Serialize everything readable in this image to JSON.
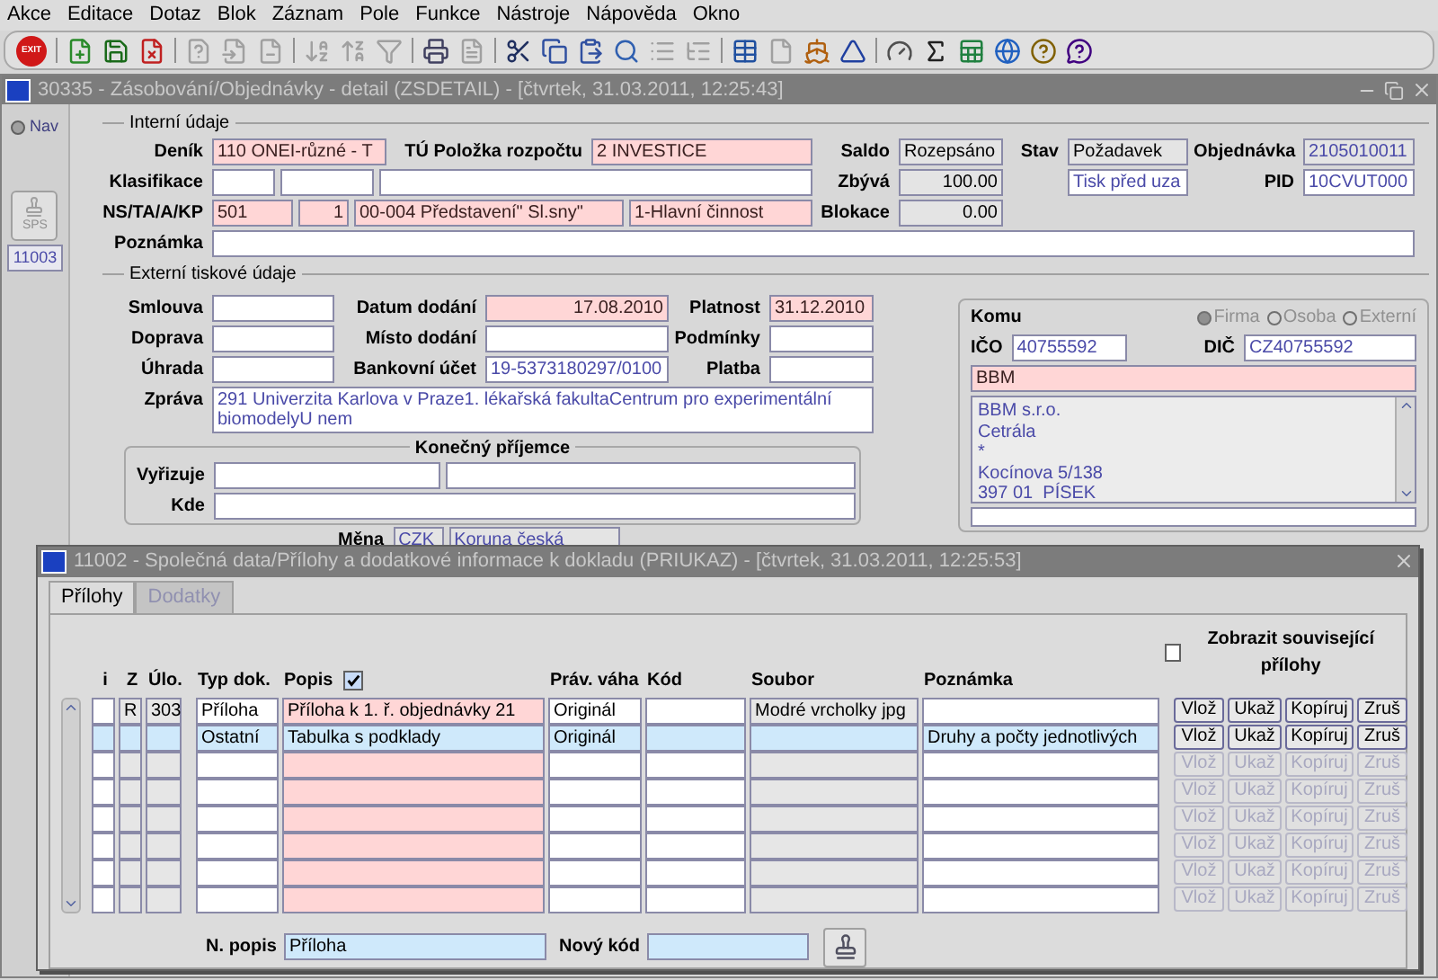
{
  "menu": [
    "Akce",
    "Editace",
    "Dotaz",
    "Blok",
    "Záznam",
    "Pole",
    "Funkce",
    "Nástroje",
    "Nápověda",
    "Okno"
  ],
  "toolbar": {
    "exit_label": "EXIT"
  },
  "main_window": {
    "title": "30335 - Zásobování/Objednávky - detail (ZSDETAIL) - [čtvrtek, 31.03.2011, 12:25:43]",
    "nav": {
      "label": "Nav",
      "selected": true
    },
    "sps_label": "SPS",
    "record_id": "11003"
  },
  "internal": {
    "legend": "Interní údaje",
    "denik": {
      "label": "Deník",
      "value": "110 ONEI-různé - T",
      "kind": "required"
    },
    "tu_polozka": {
      "label": "TÚ Položka rozpočtu",
      "value": "2 INVESTICE",
      "kind": "required"
    },
    "saldo": {
      "label": "Saldo",
      "value": "Rozepsáno",
      "kind": "readonly"
    },
    "stav": {
      "label": "Stav",
      "value": "Požadavek",
      "kind": "readonly"
    },
    "objednavka": {
      "label": "Objednávka",
      "value": "2105010011",
      "kind": "locked"
    },
    "klasifikace": {
      "label": "Klasifikace",
      "fields": [
        {
          "kind": "plain"
        },
        {
          "kind": "plain"
        },
        {
          "kind": "plain"
        }
      ]
    },
    "zbyva": {
      "label": "Zbývá",
      "value": "100.00",
      "kind": "readonly"
    },
    "tisk": {
      "value": "Tisk před uza",
      "kind": "display"
    },
    "pid": {
      "label": "PID",
      "value": "10CVUT000",
      "kind": "display"
    },
    "ns": {
      "label": "NS/TA/A/KP",
      "fields": [
        {
          "value": "501",
          "kind": "required"
        },
        {
          "value": "1",
          "kind": "required"
        },
        {
          "value": "00-004 Představení\" Sl.sny\"",
          "kind": "required"
        },
        {
          "value": "1-Hlavní činnost",
          "kind": "required"
        }
      ]
    },
    "blokace": {
      "label": "Blokace",
      "value": "0.00",
      "kind": "readonly"
    },
    "poznamka": {
      "label": "Poznámka",
      "kind": "plain"
    }
  },
  "external": {
    "legend": "Externí tiskové údaje",
    "smlouva": {
      "label": "Smlouva",
      "kind": "plain"
    },
    "datum_dodani": {
      "label": "Datum dodání",
      "value": "17.08.2010",
      "kind": "required"
    },
    "platnost": {
      "label": "Platnost",
      "value": "31.12.2010",
      "kind": "required"
    },
    "doprava": {
      "label": "Doprava",
      "kind": "plain"
    },
    "misto_dodani": {
      "label": "Místo dodání",
      "kind": "plain"
    },
    "podminky": {
      "label": "Podmínky",
      "kind": "plain"
    },
    "uhrada": {
      "label": "Úhrada",
      "kind": "plain"
    },
    "bankovni_ucet": {
      "label": "Bankovní účet",
      "value": "19-5373180297/0100",
      "kind": "display"
    },
    "platba": {
      "label": "Platba",
      "kind": "plain"
    },
    "zprava": {
      "label": "Zpráva",
      "value": "291 Univerzita Karlova v Praze1. lékařská fakultaCentrum pro experimentální biomodelyU nem",
      "kind": "display"
    },
    "konecny": {
      "legend": "Konečný příjemce",
      "vyrizuje": {
        "label": "Vyřizuje",
        "fields": [
          {
            "kind": "plain"
          },
          {
            "kind": "plain"
          }
        ]
      },
      "kde": {
        "label": "Kde",
        "kind": "plain"
      }
    },
    "mena": {
      "label": "Měna",
      "fields": [
        {
          "value": "CZK",
          "kind": "locked"
        },
        {
          "value": "Koruna česká",
          "kind": "locked"
        }
      ]
    },
    "komu": {
      "legend": "Komu",
      "radios": [
        {
          "label": "Firma",
          "selected": true
        },
        {
          "label": "Osoba",
          "selected": false
        },
        {
          "label": "Externí",
          "selected": false
        }
      ],
      "ico": {
        "label": "IČO",
        "value": "40755592",
        "kind": "display"
      },
      "dic": {
        "label": "DIČ",
        "value": "CZ40755592",
        "kind": "display"
      },
      "name": {
        "value": "BBM",
        "kind": "required"
      },
      "address_lines": [
        "BBM s.r.o.",
        "Cetrála",
        "*",
        "Kocínova 5/138",
        "397 01  PÍSEK"
      ],
      "extra": {
        "kind": "plain"
      }
    }
  },
  "dialog": {
    "title": "11002 - Společná data/Přílohy a dodatkové informace k dokladu (PRIUKAZ) - [čtvrtek, 31.03.2011, 12:25:53]",
    "tabs": [
      {
        "label": "Přílohy",
        "selected": true
      },
      {
        "label": "Dodatky",
        "selected": false
      }
    ],
    "show_related": {
      "label": "Zobrazit související přílohy",
      "checked": false
    },
    "columns": [
      "i",
      "Z",
      "Úlo.",
      "Typ dok.",
      "Popis",
      "Práv. váha",
      "Kód",
      "Soubor",
      "Poznámka"
    ],
    "popis_checkbox": {
      "checked": true
    },
    "rows": [
      {
        "selected": false,
        "enabled": true,
        "cells": {
          "z": "R",
          "ulo": "303",
          "typ": "Příloha",
          "popis": "Příloha k 1. ř. objednávky 21",
          "prav": "Originál",
          "soubor": "Modré vrcholky jpg"
        },
        "buttons": [
          "Vlož",
          "Ukaž",
          "Kopíruj",
          "Zruš"
        ]
      },
      {
        "selected": true,
        "enabled": true,
        "cells": {
          "typ": "Ostatní",
          "popis": "Tabulka s podklady",
          "prav": "Originál",
          "poznamka": "Druhy a počty jednotlivých"
        },
        "buttons": [
          "Vlož",
          "Ukaž",
          "Kopíruj",
          "Zruš"
        ]
      },
      {
        "selected": false,
        "enabled": false,
        "cells": {},
        "buttons": [
          "Vlož",
          "Ukaž",
          "Kopíruj",
          "Zruš"
        ]
      },
      {
        "selected": false,
        "enabled": false,
        "cells": {},
        "buttons": [
          "Vlož",
          "Ukaž",
          "Kopíruj",
          "Zruš"
        ]
      },
      {
        "selected": false,
        "enabled": false,
        "cells": {},
        "buttons": [
          "Vlož",
          "Ukaž",
          "Kopíruj",
          "Zruš"
        ]
      },
      {
        "selected": false,
        "enabled": false,
        "cells": {},
        "buttons": [
          "Vlož",
          "Ukaž",
          "Kopíruj",
          "Zruš"
        ]
      },
      {
        "selected": false,
        "enabled": false,
        "cells": {},
        "buttons": [
          "Vlož",
          "Ukaž",
          "Kopíruj",
          "Zruš"
        ]
      },
      {
        "selected": false,
        "enabled": false,
        "cells": {},
        "buttons": [
          "Vlož",
          "Ukaž",
          "Kopíruj",
          "Zruš"
        ]
      }
    ],
    "n_popis": {
      "label": "N. popis",
      "value": "Příloha"
    },
    "novy_kod": {
      "label": "Nový kód"
    }
  }
}
